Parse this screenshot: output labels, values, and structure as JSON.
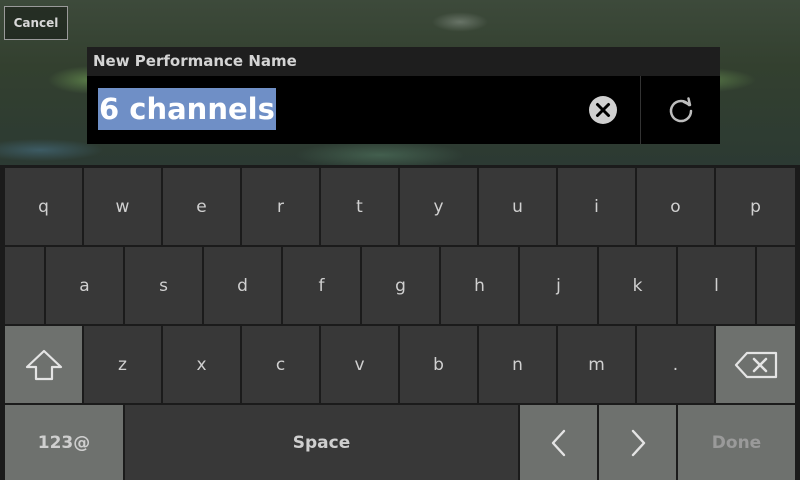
{
  "header": {
    "cancel_label": "Cancel"
  },
  "dialog": {
    "title": "New Performance Name",
    "name_value": "6 channels"
  },
  "icons": {
    "clear": "clear-circle-x-icon",
    "refresh": "refresh-icon",
    "shift": "shift-arrow-icon",
    "backspace": "backspace-icon",
    "left": "chevron-left-icon",
    "right": "chevron-right-icon"
  },
  "keyboard": {
    "row1": [
      "q",
      "w",
      "e",
      "r",
      "t",
      "y",
      "u",
      "i",
      "o",
      "p"
    ],
    "row2": [
      "a",
      "s",
      "d",
      "f",
      "g",
      "h",
      "j",
      "k",
      "l"
    ],
    "row3": [
      "z",
      "x",
      "c",
      "v",
      "b",
      "n",
      "m",
      "."
    ],
    "mode_label": "123@",
    "space_label": "Space",
    "done_label": "Done"
  },
  "colors": {
    "selection": "#6f8fc6",
    "key": "#383838",
    "function_key": "#6e716e"
  }
}
